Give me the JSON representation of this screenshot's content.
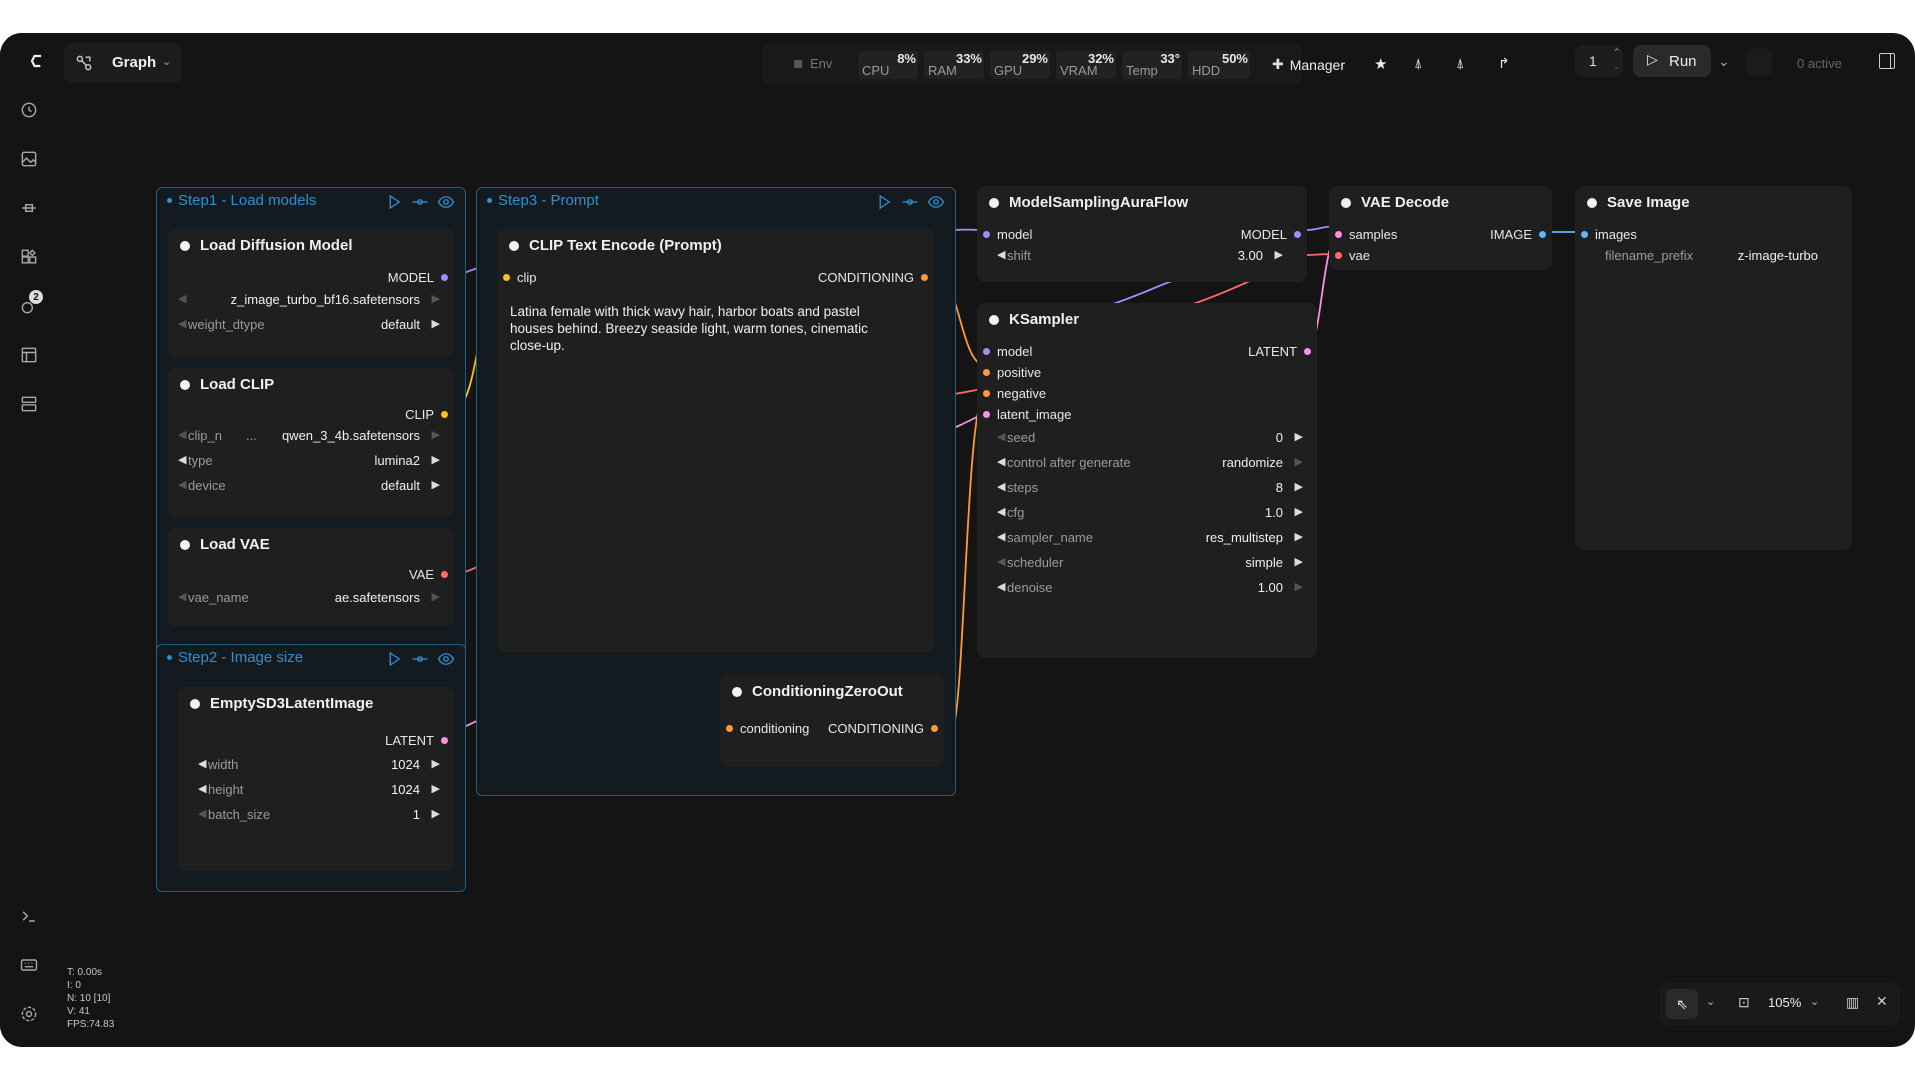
{
  "topbar": {
    "graph_label": "Graph",
    "env_label": "Env",
    "stats": [
      {
        "label": "CPU",
        "value": "8%"
      },
      {
        "label": "RAM",
        "value": "33%"
      },
      {
        "label": "GPU",
        "value": "29%"
      },
      {
        "label": "VRAM",
        "value": "32%"
      },
      {
        "label": "Temp",
        "value": "33°"
      },
      {
        "label": "HDD",
        "value": "50%"
      }
    ],
    "manager_label": "Manager",
    "queue_count": "1",
    "run_label": "Run",
    "active_label": "0 active"
  },
  "sidebar": {
    "queue_badge": "2"
  },
  "groups": {
    "step1": "Step1 - Load models",
    "step2": "Step2 - Image size",
    "step3": "Step3 - Prompt"
  },
  "nodes": {
    "load_diffusion": {
      "title": "Load Diffusion Model",
      "output": "MODEL",
      "widgets": [
        {
          "label": "",
          "value": "z_image_turbo_bf16.safetensors"
        },
        {
          "label": "weight_dtype",
          "value": "default"
        }
      ]
    },
    "load_clip": {
      "title": "Load CLIP",
      "output": "CLIP",
      "widgets": [
        {
          "label": "clip_n",
          "value": "qwen_3_4b.safetensors"
        },
        {
          "label": "type",
          "value": "lumina2"
        },
        {
          "label": "device",
          "value": "default"
        }
      ]
    },
    "load_vae": {
      "title": "Load VAE",
      "output": "VAE",
      "widgets": [
        {
          "label": "vae_name",
          "value": "ae.safetensors"
        }
      ]
    },
    "empty_latent": {
      "title": "EmptySD3LatentImage",
      "output": "LATENT",
      "widgets": [
        {
          "label": "width",
          "value": "1024"
        },
        {
          "label": "height",
          "value": "1024"
        },
        {
          "label": "batch_size",
          "value": "1"
        }
      ]
    },
    "clip_text": {
      "title": "CLIP Text Encode (Prompt)",
      "input": "clip",
      "output": "CONDITIONING",
      "prompt": "Latina female with thick wavy hair, harbor boats and pastel houses behind. Breezy seaside light, warm tones, cinematic close-up."
    },
    "cond_zero": {
      "title": "ConditioningZeroOut",
      "input": "conditioning",
      "output": "CONDITIONING"
    },
    "model_sampling": {
      "title": "ModelSamplingAuraFlow",
      "input": "model",
      "output": "MODEL",
      "widgets": [
        {
          "label": "shift",
          "value": "3.00"
        }
      ]
    },
    "ksampler": {
      "title": "KSampler",
      "inputs": [
        "model",
        "positive",
        "negative",
        "latent_image"
      ],
      "output": "LATENT",
      "widgets": [
        {
          "label": "seed",
          "value": "0"
        },
        {
          "label": "control after generate",
          "value": "randomize"
        },
        {
          "label": "steps",
          "value": "8"
        },
        {
          "label": "cfg",
          "value": "1.0"
        },
        {
          "label": "sampler_name",
          "value": "res_multistep"
        },
        {
          "label": "scheduler",
          "value": "simple"
        },
        {
          "label": "denoise",
          "value": "1.00"
        }
      ]
    },
    "vae_decode": {
      "title": "VAE Decode",
      "inputs": [
        "samples",
        "vae"
      ],
      "output": "IMAGE"
    },
    "save_image": {
      "title": "Save Image",
      "input": "images",
      "widgets": [
        {
          "label": "filename_prefix",
          "value": "z-image-turbo"
        }
      ]
    }
  },
  "canvas_stats": [
    "T: 0.00s",
    "I: 0",
    "N: 10 [10]",
    "V: 41",
    "FPS:74.83"
  ],
  "zoom": "105%",
  "colors": {
    "model": "#a78bfa",
    "clip": "#f5c518",
    "vae": "#ff6b6b",
    "conditioning": "#ff9a3c",
    "latent": "#ff8ee6",
    "image": "#5fb3ff",
    "group": "#2f8fcf"
  }
}
